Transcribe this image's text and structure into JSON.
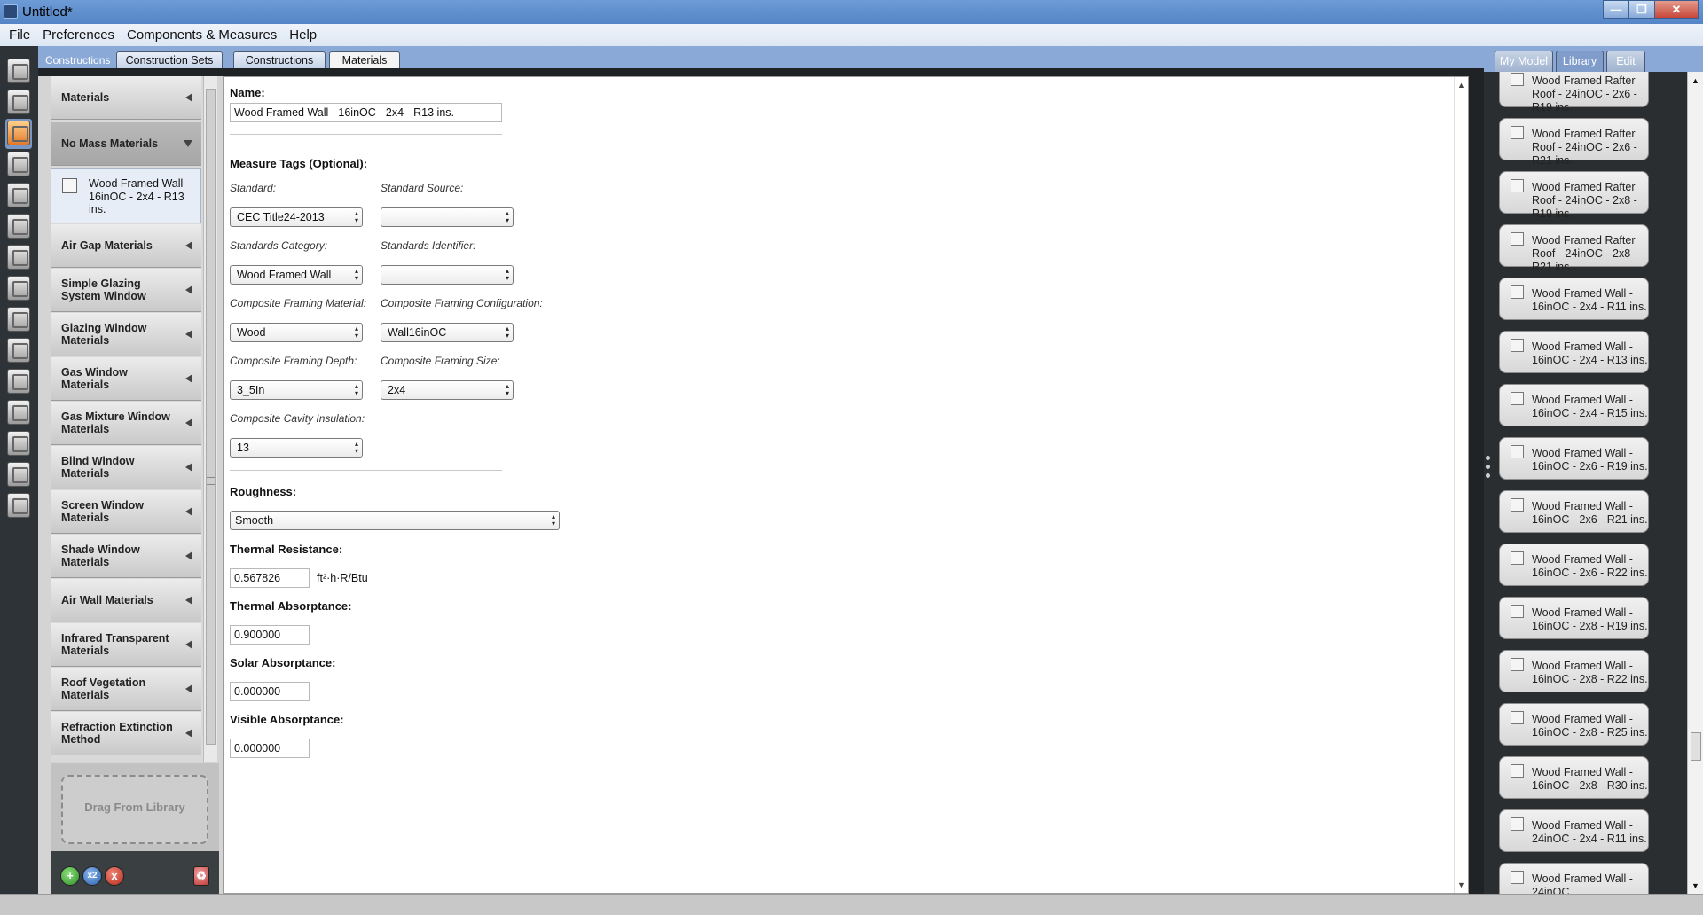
{
  "window": {
    "title": "Untitled*"
  },
  "menu": [
    "File",
    "Preferences",
    "Components & Measures",
    "Help"
  ],
  "tabs": {
    "section_label": "Constructions",
    "items": [
      "Construction Sets",
      "Constructions",
      "Materials"
    ]
  },
  "categories": [
    "Materials",
    "No Mass Materials",
    "Air Gap Materials",
    "Simple Glazing System Window",
    "Glazing Window Materials",
    "Gas Window Materials",
    "Gas Mixture Window Materials",
    "Blind Window Materials",
    "Screen Window Materials",
    "Shade Window Materials",
    "Air Wall Materials",
    "Infrared Transparent Materials",
    "Roof Vegetation Materials",
    "Refraction Extinction Method"
  ],
  "selected_item": "Wood Framed Wall - 16inOC - 2x4 - R13 ins.",
  "dropzone": "Drag From Library",
  "form": {
    "name_label": "Name:",
    "name_value": "Wood Framed Wall - 16inOC - 2x4 - R13 ins.",
    "measure_tags_label": "Measure Tags (Optional):",
    "standard_label": "Standard:",
    "standard_value": "CEC Title24-2013",
    "standard_source_label": "Standard Source:",
    "standard_source_value": "",
    "standards_category_label": "Standards Category:",
    "standards_category_value": "Wood Framed Wall",
    "standards_identifier_label": "Standards Identifier:",
    "standards_identifier_value": "",
    "framing_material_label": "Composite Framing Material:",
    "framing_material_value": "Wood",
    "framing_config_label": "Composite Framing Configuration:",
    "framing_config_value": "Wall16inOC",
    "framing_depth_label": "Composite Framing Depth:",
    "framing_depth_value": "3_5In",
    "framing_size_label": "Composite Framing Size:",
    "framing_size_value": "2x4",
    "cavity_insulation_label": "Composite Cavity Insulation:",
    "cavity_insulation_value": "13",
    "roughness_label": "Roughness:",
    "roughness_value": "Smooth",
    "thermal_resistance_label": "Thermal Resistance:",
    "thermal_resistance_value": "0.567826",
    "thermal_resistance_unit": "ft²·h·R/Btu",
    "thermal_absorptance_label": "Thermal Absorptance:",
    "thermal_absorptance_value": "0.900000",
    "solar_absorptance_label": "Solar Absorptance:",
    "solar_absorptance_value": "0.000000",
    "visible_absorptance_label": "Visible Absorptance:",
    "visible_absorptance_value": "0.000000"
  },
  "library": {
    "tabs": [
      "My Model",
      "Library",
      "Edit"
    ],
    "active_tab": "Library",
    "items": [
      "Wood Framed Rafter Roof - 24inOC - 2x6 - R19 ins.",
      "Wood Framed Rafter Roof - 24inOC - 2x6 - R21 ins.",
      "Wood Framed Rafter Roof - 24inOC - 2x8 - R19 ins.",
      "Wood Framed Rafter Roof - 24inOC - 2x8 - R21 ins.",
      "Wood Framed Wall - 16inOC - 2x4 - R11 ins.",
      "Wood Framed Wall - 16inOC - 2x4 - R13 ins.",
      "Wood Framed Wall - 16inOC - 2x4 - R15 ins.",
      "Wood Framed Wall - 16inOC - 2x6 - R19 ins.",
      "Wood Framed Wall - 16inOC - 2x6 - R21 ins.",
      "Wood Framed Wall - 16inOC - 2x6 - R22 ins.",
      "Wood Framed Wall - 16inOC - 2x8 - R19 ins.",
      "Wood Framed Wall - 16inOC - 2x8 - R22 ins.",
      "Wood Framed Wall - 16inOC - 2x8 - R25 ins.",
      "Wood Framed Wall - 16inOC - 2x8 - R30 ins.",
      "Wood Framed Wall - 24inOC - 2x4 - R11 ins.",
      "Wood Framed Wall - 24inOC"
    ]
  },
  "icons": {
    "tool_icons": [
      "site-icon",
      "schedules-icon",
      "constructions-icon",
      "loads-icon",
      "space-types-icon",
      "geometry-icon",
      "facility-icon",
      "spaces-icon",
      "thermal-zones-icon",
      "hvac-icon",
      "output-variables-icon",
      "simulation-settings-icon",
      "measures-icon",
      "run-icon",
      "results-icon"
    ],
    "buttons": {
      "add": "+",
      "copy": "x2",
      "remove": "x"
    }
  },
  "colors": {
    "accent": "#8aa9d7",
    "titlebar": "#5a8ac8",
    "frame": "#1f2326"
  }
}
